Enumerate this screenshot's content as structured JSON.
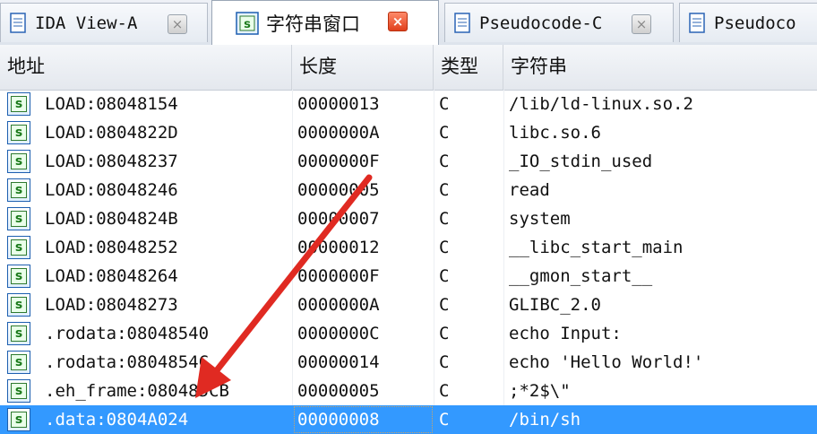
{
  "tabs": [
    {
      "label": "IDA View-A",
      "active": false,
      "close": "×"
    },
    {
      "label": "字符串窗口",
      "active": true,
      "close": "×"
    },
    {
      "label": "Pseudocode-C",
      "active": false,
      "close": "×"
    },
    {
      "label": "Pseudoco",
      "active": false
    }
  ],
  "columns": {
    "address": "地址",
    "length": "长度",
    "type": "类型",
    "string": "字符串"
  },
  "row_icon": "s",
  "rows": [
    {
      "address": "LOAD:08048154",
      "length": "00000013",
      "type": "C",
      "string": "/lib/ld-linux.so.2"
    },
    {
      "address": "LOAD:0804822D",
      "length": "0000000A",
      "type": "C",
      "string": "libc.so.6"
    },
    {
      "address": "LOAD:08048237",
      "length": "0000000F",
      "type": "C",
      "string": "_IO_stdin_used"
    },
    {
      "address": "LOAD:08048246",
      "length": "00000005",
      "type": "C",
      "string": "read"
    },
    {
      "address": "LOAD:0804824B",
      "length": "00000007",
      "type": "C",
      "string": "system"
    },
    {
      "address": "LOAD:08048252",
      "length": "00000012",
      "type": "C",
      "string": "__libc_start_main"
    },
    {
      "address": "LOAD:08048264",
      "length": "0000000F",
      "type": "C",
      "string": "__gmon_start__"
    },
    {
      "address": "LOAD:08048273",
      "length": "0000000A",
      "type": "C",
      "string": "GLIBC_2.0"
    },
    {
      "address": ".rodata:08048540",
      "length": "0000000C",
      "type": "C",
      "string": "echo Input:"
    },
    {
      "address": ".rodata:0804854C",
      "length": "00000014",
      "type": "C",
      "string": "echo 'Hello World!'"
    },
    {
      "address": ".eh_frame:080485CB",
      "length": "00000005",
      "type": "C",
      "string": ";*2$\\\""
    },
    {
      "address": ".data:0804A024",
      "length": "00000008",
      "type": "C",
      "string": "/bin/sh",
      "selected": true
    }
  ],
  "colors": {
    "selection": "#3399ff",
    "arrow": "#e02a22"
  }
}
